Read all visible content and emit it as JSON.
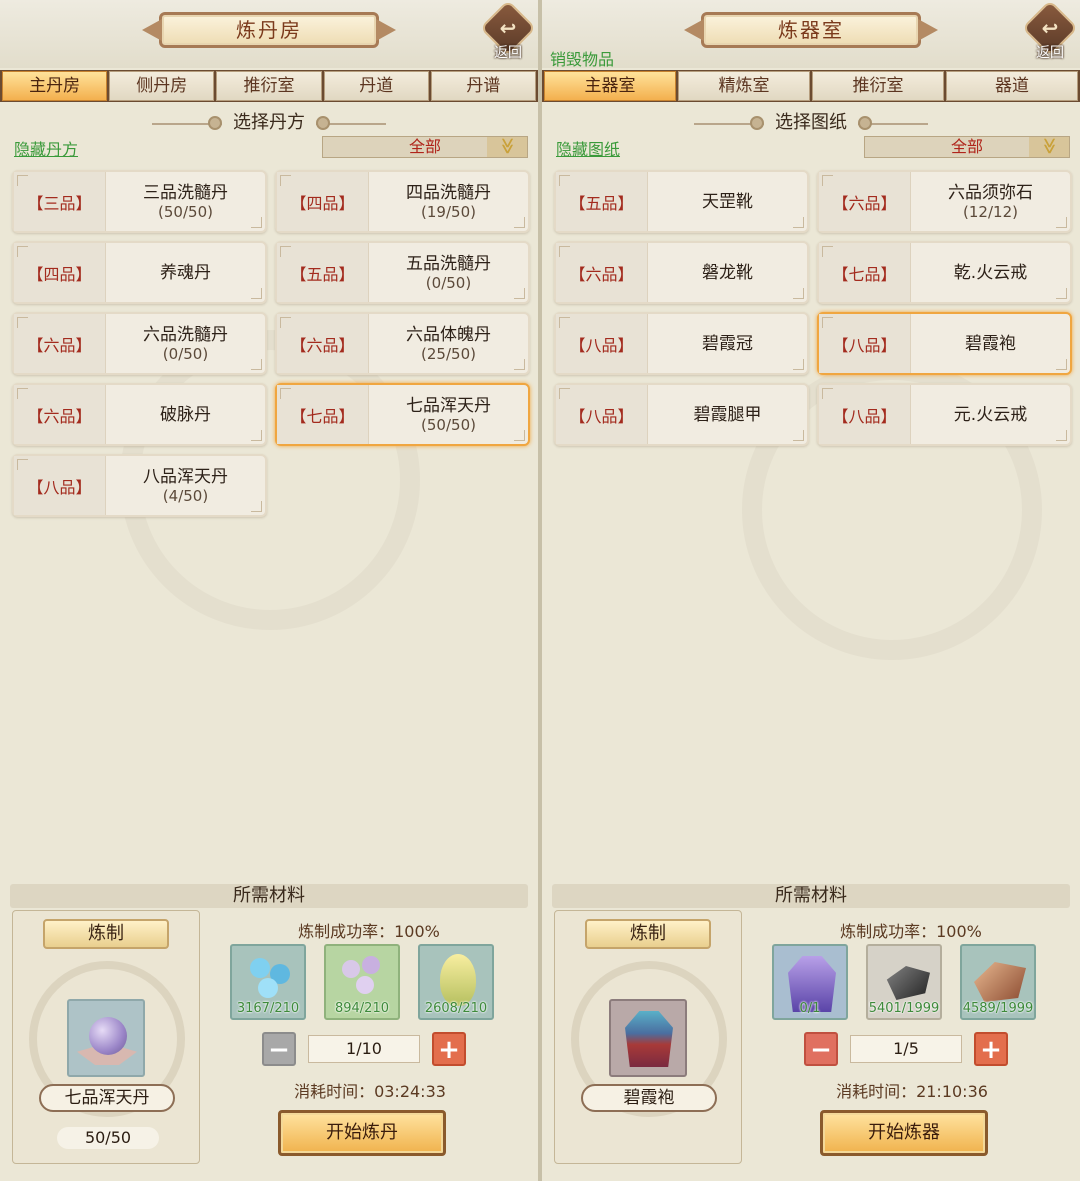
{
  "left": {
    "title": "炼丹房",
    "back_label": "返回",
    "tabs": [
      "主丹房",
      "侧丹房",
      "推衍室",
      "丹道",
      "丹谱"
    ],
    "section_title": "选择丹方",
    "hide_link": "隐藏丹方",
    "filter": "全部",
    "recipes": [
      {
        "grade": "【三品】",
        "name": "三品洗髓丹",
        "count": "(50/50)"
      },
      {
        "grade": "【四品】",
        "name": "四品洗髓丹",
        "count": "(19/50)"
      },
      {
        "grade": "【四品】",
        "name": "养魂丹",
        "count": ""
      },
      {
        "grade": "【五品】",
        "name": "五品洗髓丹",
        "count": "(0/50)"
      },
      {
        "grade": "【六品】",
        "name": "六品洗髓丹",
        "count": "(0/50)"
      },
      {
        "grade": "【六品】",
        "name": "六品体魄丹",
        "count": "(25/50)"
      },
      {
        "grade": "【六品】",
        "name": "破脉丹",
        "count": ""
      },
      {
        "grade": "【七品】",
        "name": "七品浑天丹",
        "count": "(50/50)"
      },
      {
        "grade": "【八品】",
        "name": "八品浑天丹",
        "count": "(4/50)"
      }
    ],
    "materials_title": "所需材料",
    "craft_label": "炼制",
    "craft_item_name": "七品浑天丹",
    "craft_item_count": "50/50",
    "success_rate": "炼制成功率：100%",
    "materials": [
      "3167/210",
      "894/210",
      "2608/210"
    ],
    "quantity": "1/10",
    "time": "消耗时间：03:24:33",
    "start_button": "开始炼丹"
  },
  "right": {
    "title": "炼器室",
    "back_label": "返回",
    "destroy_link": "销毁物品",
    "tabs": [
      "主器室",
      "精炼室",
      "推衍室",
      "器道"
    ],
    "section_title": "选择图纸",
    "hide_link": "隐藏图纸",
    "filter": "全部",
    "recipes": [
      {
        "grade": "【五品】",
        "name": "天罡靴",
        "count": ""
      },
      {
        "grade": "【六品】",
        "name": "六品须弥石",
        "count": "(12/12)"
      },
      {
        "grade": "【六品】",
        "name": "磐龙靴",
        "count": ""
      },
      {
        "grade": "【七品】",
        "name": "乾.火云戒",
        "count": ""
      },
      {
        "grade": "【八品】",
        "name": "碧霞冠",
        "count": ""
      },
      {
        "grade": "【八品】",
        "name": "碧霞袍",
        "count": ""
      },
      {
        "grade": "【八品】",
        "name": "碧霞腿甲",
        "count": ""
      },
      {
        "grade": "【八品】",
        "name": "元.火云戒",
        "count": ""
      }
    ],
    "materials_title": "所需材料",
    "craft_label": "炼制",
    "craft_item_name": "碧霞袍",
    "success_rate": "炼制成功率：100%",
    "materials": [
      "0/1",
      "5401/1999",
      "4589/1999"
    ],
    "quantity": "1/5",
    "time": "消耗时间：21:10:36",
    "start_button": "开始炼器"
  },
  "selection": {
    "left_selected_recipe": "七品浑天丹",
    "right_selected_recipe": "碧霞袍"
  },
  "colors": {
    "accent_tab": "#f3b04e",
    "selected_border": "#f0a640",
    "link_green": "#3a9a3a",
    "grade_red": "#a32b1e"
  },
  "icons": {
    "back": "back-arrow-icon",
    "dropdown": "chevron-down-icon",
    "minus": "minus-icon",
    "plus": "plus-icon"
  }
}
